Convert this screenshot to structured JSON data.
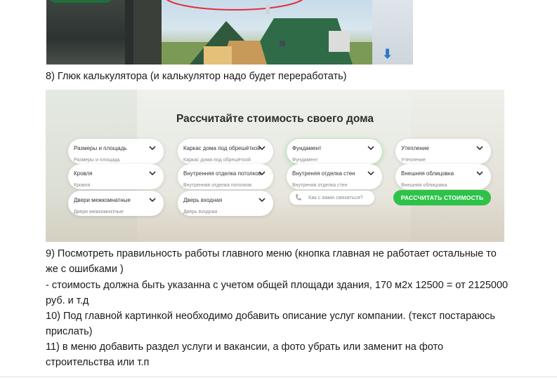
{
  "top_screenshot": {
    "arrow_icon": "arrow-down-icon"
  },
  "item8": "8) Глюк калькулятора (и калькулятор надо будет переработать)",
  "calculator": {
    "title": "Рассчитайте стоимость своего дома",
    "fields": [
      {
        "label": "Размеры и площадь",
        "sub": "Размеры и площадь"
      },
      {
        "label": "Каркас дома под обрешёткой",
        "sub": "Каркас дома под обрешёткой"
      },
      {
        "label": "Фундамент",
        "sub": "Фундамент"
      },
      {
        "label": "Утепление",
        "sub": "Утепление"
      },
      {
        "label": "Кровля",
        "sub": "Кровля"
      },
      {
        "label": "Внутренняя отделка потолков",
        "sub": "Внутренняя отделка потолков"
      },
      {
        "label": "Внутреняя отделка стен",
        "sub": "Внутреняя отделка стен"
      },
      {
        "label": "Внешняя облицовка",
        "sub": "Внешняя облицовка"
      },
      {
        "label": "Двери межкомнатные",
        "sub": "Двери межкомнатные"
      },
      {
        "label": "Дверь входная",
        "sub": "Дверь входная"
      }
    ],
    "phone_placeholder": "Как с вами связаться?",
    "submit_label": "РАССЧИТАТЬ СТОИМОСТЬ",
    "accent_color": "#2ec24a"
  },
  "notes": {
    "item9_line1": "9) Посмотреть правильность работы главного меню (кнопка главная не работает остальные то",
    "item9_line2": "же с ошибками )",
    "cost_line1": "- стоимость должна быть указанна с учетом общей площади здания, 170 м2х 12500 = от 2125000",
    "cost_line2": "руб. и т.д",
    "item10_line1": "10) Под главной картинкой необходимо добавить описание услуг компании. (текст постараюсь",
    "item10_line2": "прислать)",
    "item11_line1": "11) в меню добавить раздел услуги и вакансии, а фото убрать или заменит на фото",
    "item11_line2": "строительства или т.п"
  }
}
